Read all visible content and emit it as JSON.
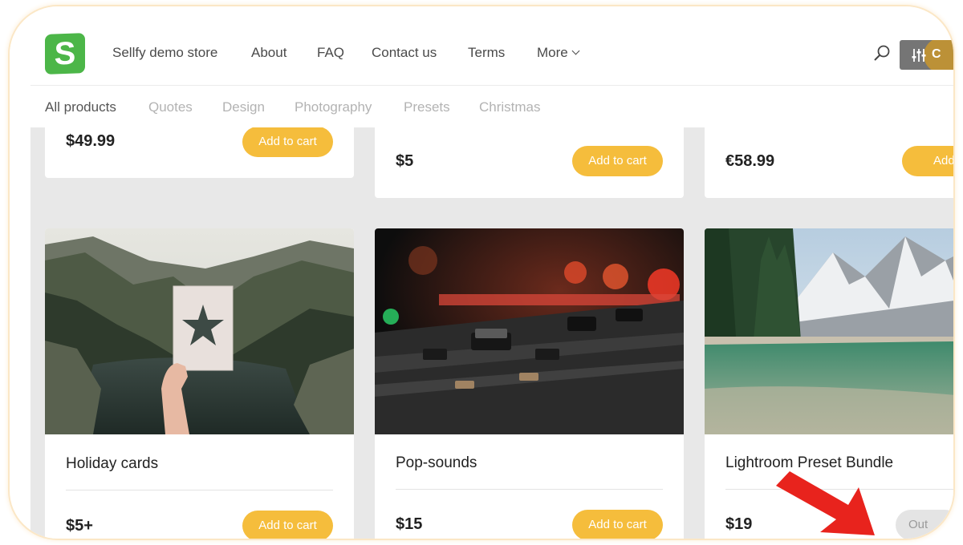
{
  "store": {
    "logo_letter": "S",
    "nav": [
      {
        "label": "Sellfy demo store"
      },
      {
        "label": "About"
      },
      {
        "label": "FAQ"
      },
      {
        "label": "Contact us"
      },
      {
        "label": "Terms"
      },
      {
        "label": "More"
      }
    ],
    "cart_label": "C"
  },
  "categories": [
    {
      "label": "All products",
      "active": true
    },
    {
      "label": "Quotes"
    },
    {
      "label": "Design"
    },
    {
      "label": "Photography"
    },
    {
      "label": "Presets"
    },
    {
      "label": "Christmas"
    }
  ],
  "products_top": [
    {
      "price": "$49.99",
      "button": "Add to cart"
    },
    {
      "price": "$5",
      "button": "Add to cart"
    },
    {
      "price": "€58.99",
      "button": "Add t"
    }
  ],
  "products": [
    {
      "title": "Holiday cards",
      "price": "$5+",
      "button": "Add to cart",
      "image": "canyon-star-card-photo"
    },
    {
      "title": "Pop-sounds",
      "price": "$15",
      "button": "Add to cart",
      "image": "mixing-console-photo"
    },
    {
      "title": "Lightroom Preset Bundle",
      "price": "$19",
      "button": "Out",
      "image": "mountain-lake-photo"
    }
  ],
  "colors": {
    "accent": "#f5bd3c",
    "logo_green": "#4cb648",
    "annotation_arrow": "#e8231d",
    "page_bg": "#e8e8e8"
  }
}
